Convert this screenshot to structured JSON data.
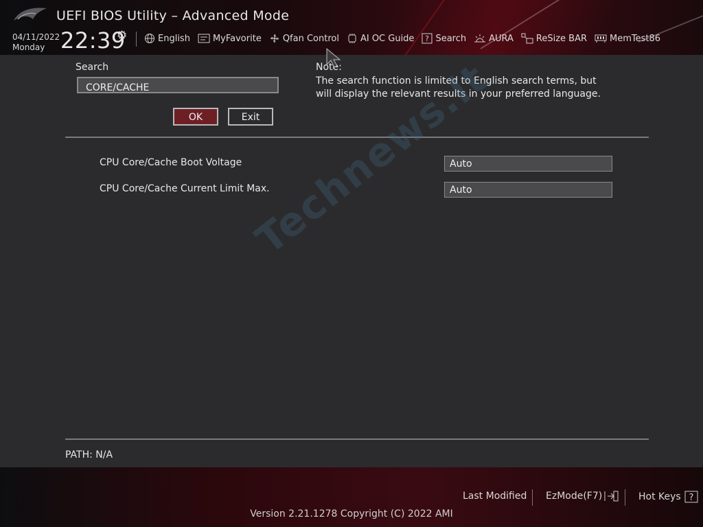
{
  "header": {
    "title": "UEFI BIOS Utility – Advanced Mode",
    "date": "04/11/2022",
    "day": "Monday",
    "time": "22:39",
    "nav": [
      {
        "label": "English",
        "icon": "globe-icon"
      },
      {
        "label": "MyFavorite",
        "icon": "favorite-icon"
      },
      {
        "label": "Qfan Control",
        "icon": "fan-icon"
      },
      {
        "label": "AI OC Guide",
        "icon": "ai-chip-icon"
      },
      {
        "label": "Search",
        "icon": "question-box-icon"
      },
      {
        "label": "AURA",
        "icon": "aura-light-icon"
      },
      {
        "label": "ReSize BAR",
        "icon": "resize-bar-icon"
      },
      {
        "label": "MemTest86",
        "icon": "memory-icon"
      }
    ]
  },
  "search": {
    "label": "Search",
    "value": "CORE/CACHE",
    "ok_label": "OK",
    "exit_label": "Exit"
  },
  "note": {
    "label": "Note:",
    "text": "The search function is limited to English search terms, but will display the relevant results in your preferred language."
  },
  "results": [
    {
      "label": "CPU Core/Cache Boot Voltage",
      "value": "Auto"
    },
    {
      "label": "CPU Core/Cache Current Limit Max.",
      "value": "Auto"
    }
  ],
  "path": "PATH: N/A",
  "footer": {
    "last_modified": "Last Modified",
    "ezmode": "EzMode(F7)",
    "hot_keys": "Hot Keys",
    "version": "Version 2.21.1278 Copyright (C) 2022 AMI"
  },
  "watermark": "Technews.lt",
  "colors": {
    "background": "#2b2b2d",
    "accent_red": "#6e1f24",
    "field_bg": "#4a4a4c"
  }
}
